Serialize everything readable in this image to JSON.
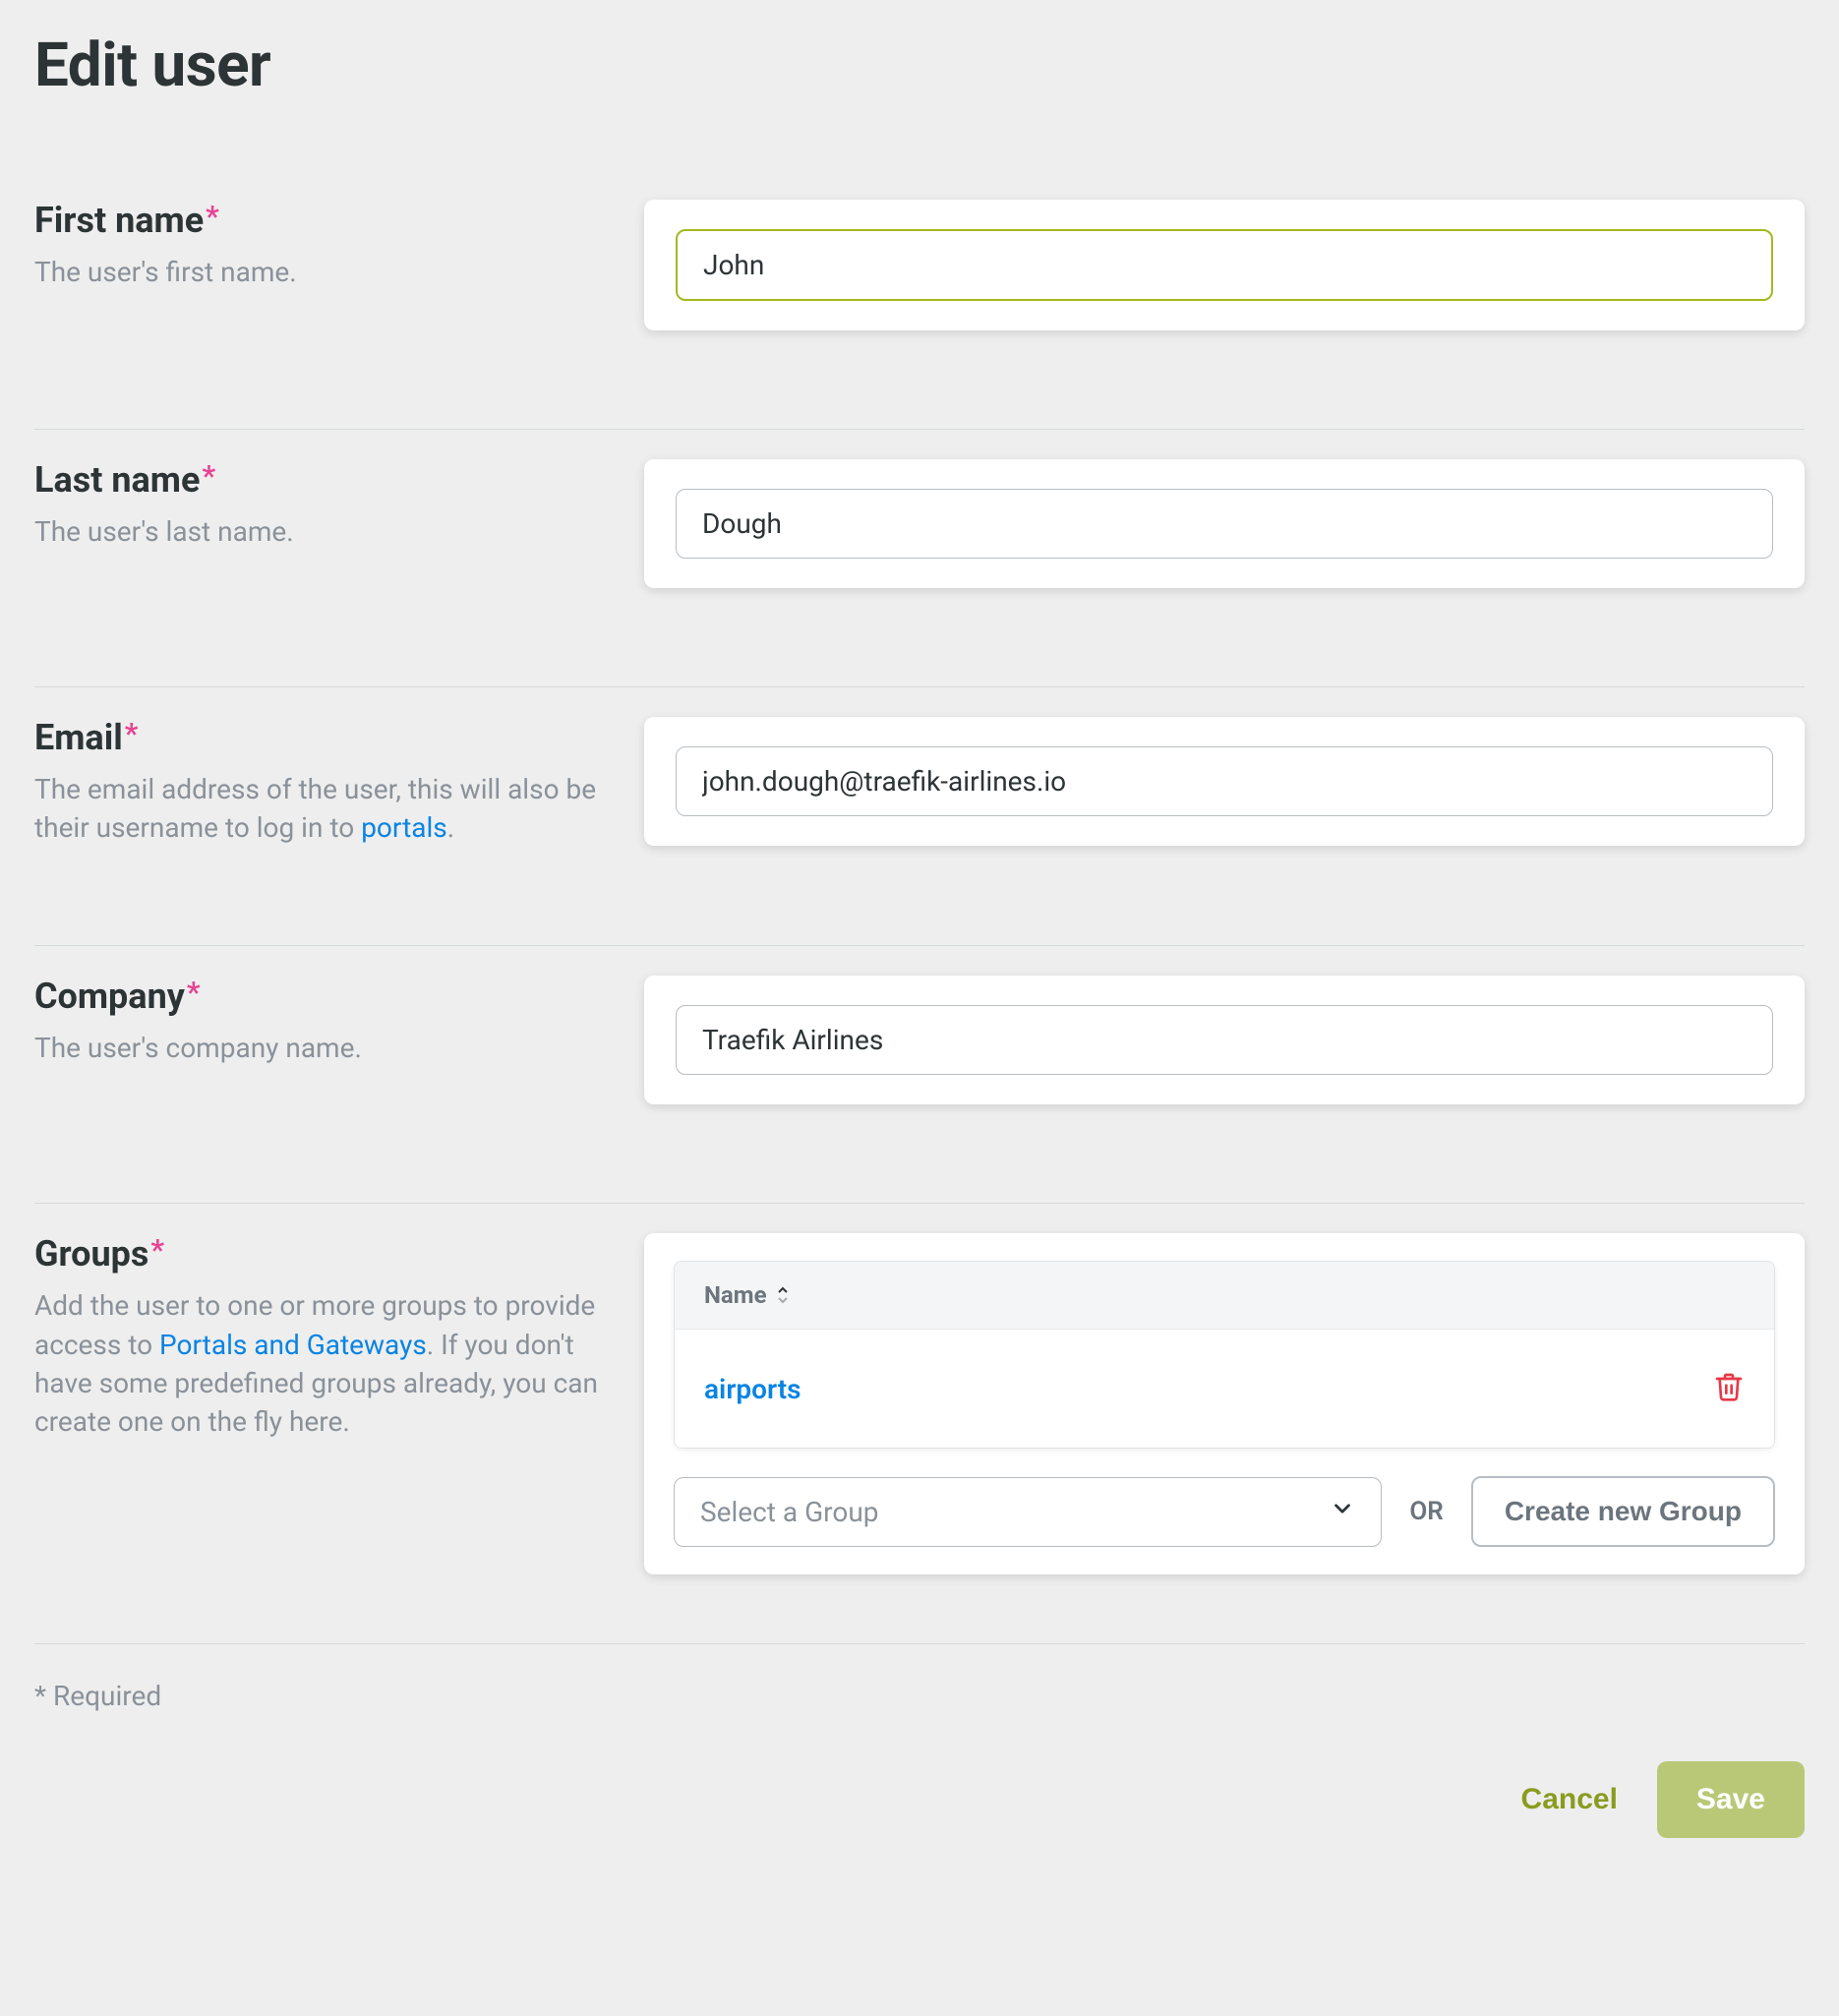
{
  "page": {
    "title": "Edit user"
  },
  "fields": {
    "first_name": {
      "label": "First name",
      "desc": "The user's first name.",
      "value": "John"
    },
    "last_name": {
      "label": "Last name",
      "desc": "The user's last name.",
      "value": "Dough"
    },
    "email": {
      "label": "Email",
      "desc_prefix": "The email address of the user, this will also be their username to log in to ",
      "desc_link": "portals",
      "desc_suffix": ".",
      "value": "john.dough@traefik-airlines.io"
    },
    "company": {
      "label": "Company",
      "desc": "The user's company name.",
      "value": "Traefik Airlines"
    },
    "groups": {
      "label": "Groups",
      "desc_prefix": "Add the user to one or more groups to provide access to ",
      "desc_link": "Portals and Gateways",
      "desc_suffix": ". If you don't have some predefined groups already, you can create one on the fly here.",
      "column_header": "Name",
      "rows": [
        {
          "name": "airports"
        }
      ],
      "select_placeholder": "Select a Group",
      "or_text": "OR",
      "create_button": "Create new Group"
    }
  },
  "footer": {
    "required_note": "* Required",
    "cancel_label": "Cancel",
    "save_label": "Save"
  },
  "required_marker": "*"
}
